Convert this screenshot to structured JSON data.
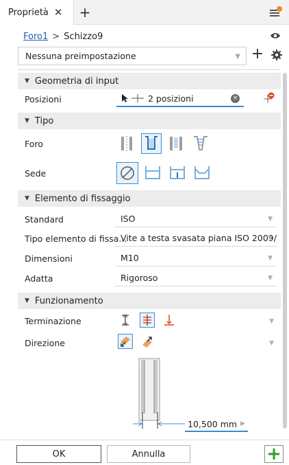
{
  "tabbar": {
    "tab_label": "Proprietà",
    "close_glyph": "✕",
    "add_glyph": "+"
  },
  "breadcrumb": {
    "item1": "Foro1",
    "separator": ">",
    "item2": "Schizzo9"
  },
  "preset": {
    "value": "Nessuna preimpostazione",
    "add_glyph": "+"
  },
  "sections": {
    "input_geometry": {
      "title": "Geometria di input",
      "positions_label": "Posizioni",
      "positions_value": "2 posizioni",
      "clear_glyph": "×"
    },
    "type": {
      "title": "Tipo",
      "hole_label": "Foro",
      "seat_label": "Sede"
    },
    "fastener": {
      "title": "Elemento di fissaggio",
      "rows": [
        {
          "label": "Standard",
          "value": "ISO"
        },
        {
          "label": "Tipo elemento di fissa...",
          "value": "Vite a testa svasata piana ISO 2009/"
        },
        {
          "label": "Dimensioni",
          "value": "M10"
        },
        {
          "label": "Adatta",
          "value": "Rigoroso"
        }
      ]
    },
    "behavior": {
      "title": "Funzionamento",
      "termination_label": "Terminazione",
      "direction_label": "Direzione"
    }
  },
  "diagram": {
    "distance": "10,500 mm"
  },
  "footer": {
    "ok": "OK",
    "cancel": "Annulla"
  },
  "colors": {
    "accent": "#3a8bd8",
    "link": "#1b5fb5",
    "add_green": "#2aa12a",
    "alert": "#e8411c",
    "notify_orange": "#f08a24"
  }
}
